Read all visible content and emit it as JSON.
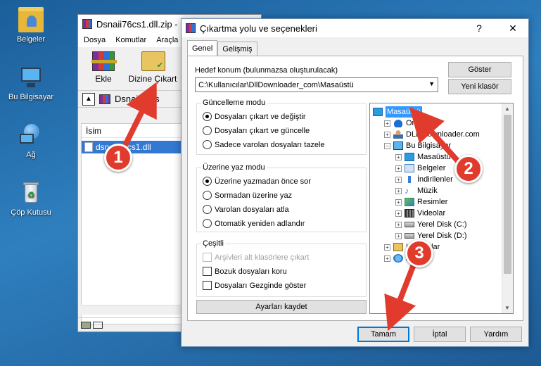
{
  "desktop": {
    "icons": [
      {
        "label": "Belgeler",
        "icon": "documents-folder-icon"
      },
      {
        "label": "Bu Bilgisayar",
        "icon": "this-pc-icon"
      },
      {
        "label": "Ağ",
        "icon": "network-icon"
      },
      {
        "label": "Çöp Kutusu",
        "icon": "recycle-bin-icon"
      }
    ]
  },
  "winrar": {
    "title": "Dsnaii76cs1.dll.zip -",
    "menu": [
      "Dosya",
      "Komutlar",
      "Araçla"
    ],
    "toolbar": {
      "add_label": "Ekle",
      "extract_label": "Dizine Çıkart"
    },
    "path": "Dsnaii76cs",
    "column_name": "İsim",
    "file": "dsnaii76cs1.dll"
  },
  "dialog": {
    "title": "Çıkartma yolu ve seçenekleri",
    "help_glyph": "?",
    "close_glyph": "✕",
    "tabs": [
      "Genel",
      "Gelişmiş"
    ],
    "destination_label": "Hedef konum (bulunmazsa oluşturulacak)",
    "destination_value": "C:\\Kullanıcılar\\DllDownloader_com\\Masaüstü",
    "show_button": "Göster",
    "new_folder_button": "Yeni klasör",
    "update_mode": {
      "title": "Güncelleme modu",
      "options": [
        "Dosyaları çıkart ve değiştir",
        "Dosyaları çıkart ve güncelle",
        "Sadece varolan dosyaları tazele"
      ],
      "selected": 0
    },
    "overwrite_mode": {
      "title": "Üzerine yaz modu",
      "options": [
        "Üzerine yazmadan önce sor",
        "Sormadan üzerine yaz",
        "Varolan dosyaları atla",
        "Otomatik yeniden adlandır"
      ],
      "selected": 0
    },
    "misc": {
      "title": "Çeşitli",
      "options": [
        "Arşivleri alt klasörlere çıkart",
        "Bozuk dosyaları koru",
        "Dosyaları Gezginde göster"
      ],
      "disabled": [
        true,
        false,
        false
      ]
    },
    "save_settings_button": "Ayarları kaydet",
    "tree": [
      {
        "label": "Masaüstü",
        "icon": "desktop-icon",
        "level": 0,
        "expander": "",
        "selected": true
      },
      {
        "label": "OneDrive",
        "icon": "onedrive-icon",
        "level": 1,
        "expander": "+"
      },
      {
        "label": "DLL Downloader.com",
        "icon": "user-folder-icon",
        "level": 1,
        "expander": "+"
      },
      {
        "label": "Bu Bilgisayar",
        "icon": "this-pc-icon",
        "level": 1,
        "expander": "−"
      },
      {
        "label": "Masaüstü",
        "icon": "desktop-icon",
        "level": 2,
        "expander": "+"
      },
      {
        "label": "Belgeler",
        "icon": "documents-icon",
        "level": 2,
        "expander": "+"
      },
      {
        "label": "İndirilenler",
        "icon": "downloads-icon",
        "level": 2,
        "expander": "+"
      },
      {
        "label": "Müzik",
        "icon": "music-icon",
        "level": 2,
        "expander": "+"
      },
      {
        "label": "Resimler",
        "icon": "pictures-icon",
        "level": 2,
        "expander": "+"
      },
      {
        "label": "Videolar",
        "icon": "videos-icon",
        "level": 2,
        "expander": "+"
      },
      {
        "label": "Yerel Disk (C:)",
        "icon": "disk-icon",
        "level": 2,
        "expander": "+"
      },
      {
        "label": "Yerel Disk (D:)",
        "icon": "disk-icon",
        "level": 2,
        "expander": "+"
      },
      {
        "label": "Kitaplıklar",
        "icon": "libraries-icon",
        "level": 1,
        "expander": "+"
      },
      {
        "label": "Ağ",
        "icon": "network-icon",
        "level": 1,
        "expander": "+"
      }
    ],
    "ok_button": "Tamam",
    "cancel_button": "İptal",
    "help_button": "Yardım"
  },
  "annotations": {
    "step1": "1",
    "step2": "2",
    "step3": "3",
    "color": "#e03b2d"
  }
}
